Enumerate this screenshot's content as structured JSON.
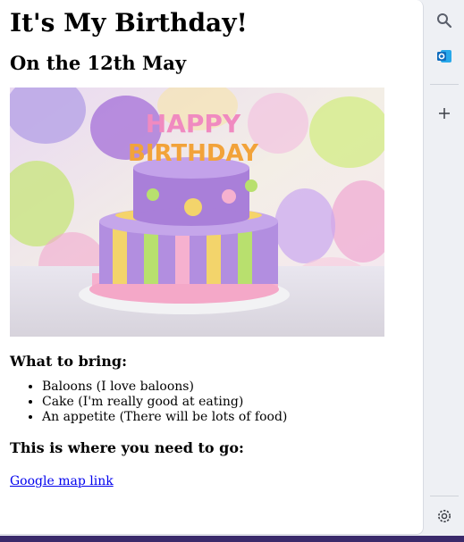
{
  "page": {
    "title": "It's My Birthday!",
    "date": "On the 12th May",
    "cake_text_line1": "HAPPY",
    "cake_text_line2": "BIRTHDAY",
    "bring_heading": "What to bring:",
    "bring_items": [
      "Baloons (I love baloons)",
      "Cake (I'm really good at eating)",
      "An appetite (There will be lots of food)"
    ],
    "where_heading": "This is where you need to go:",
    "map_link": "Google map link"
  },
  "sidebar": {
    "icons": [
      "search-icon",
      "outlook-icon",
      "add-icon",
      "settings-icon"
    ]
  },
  "colors": {
    "link": "#0000ee",
    "bottom_strip": "#3a2a6b",
    "outlook": "#0f6cbd"
  }
}
